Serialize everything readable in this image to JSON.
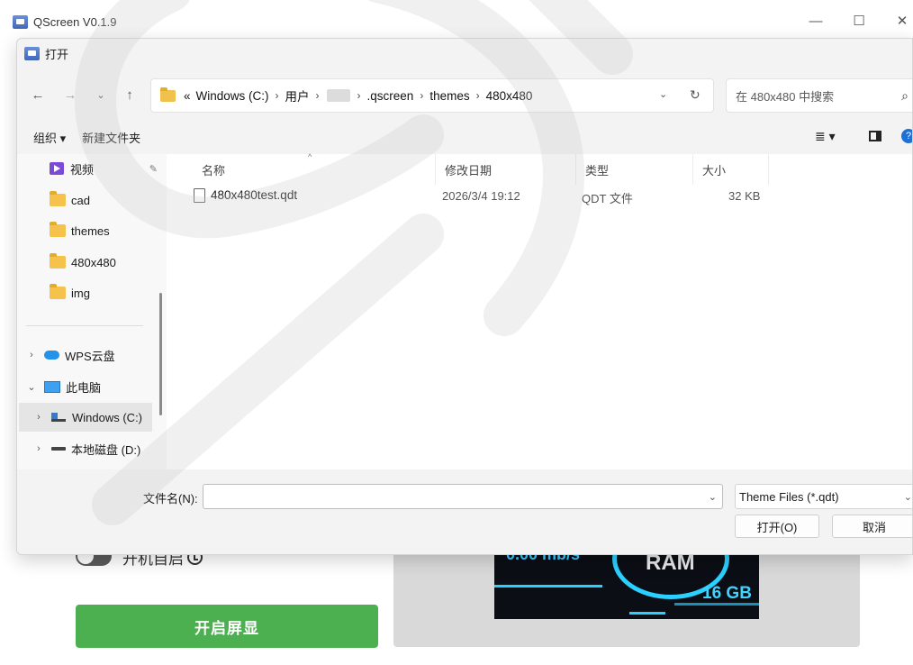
{
  "app": {
    "title": "QScreen V0.1.9",
    "autostart_label": "开机自启",
    "start_button": "开启屏显",
    "preview": {
      "speed": "0.00 mb/s",
      "ram_label": "RAM",
      "ram_size": "16 GB"
    }
  },
  "dialog": {
    "title": "打开",
    "address": {
      "prefix": "«",
      "crumbs": [
        "Windows (C:)",
        "用户",
        "",
        ".qscreen",
        "themes",
        "480x480"
      ]
    },
    "search_placeholder": "在 480x480 中搜索",
    "toolbar": {
      "organize": "组织 ▾",
      "new_folder": "新建文件夹"
    },
    "sidebar": {
      "items": [
        {
          "label": "视频",
          "icon": "video-icon"
        },
        {
          "label": "cad",
          "icon": "folder-icon"
        },
        {
          "label": "themes",
          "icon": "folder-icon"
        },
        {
          "label": "480x480",
          "icon": "folder-icon"
        },
        {
          "label": "img",
          "icon": "folder-icon"
        },
        {
          "label": "WPS云盘",
          "icon": "cloud-icon"
        },
        {
          "label": "此电脑",
          "icon": "pc-icon"
        },
        {
          "label": "Windows (C:)",
          "icon": "drive-icon"
        },
        {
          "label": "本地磁盘 (D:)",
          "icon": "hdd-icon"
        }
      ]
    },
    "columns": {
      "name": "名称",
      "modified": "修改日期",
      "type": "类型",
      "size": "大小"
    },
    "files": [
      {
        "name": "480x480test.qdt",
        "modified": "2026/3/4 19:12",
        "type": "QDT 文件",
        "size": "32 KB"
      }
    ],
    "filename_label": "文件名(N):",
    "filename_value": "",
    "filetype": "Theme Files (*.qdt)",
    "open_button": "打开(O)",
    "cancel_button": "取消"
  }
}
